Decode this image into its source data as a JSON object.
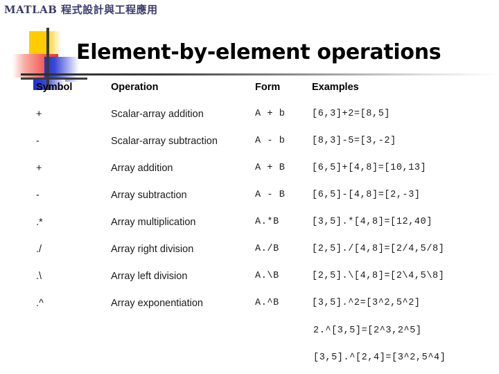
{
  "header": {
    "running_title": "MATLAB 程式設計與工程應用"
  },
  "title": {
    "text": "Element-by-element operations"
  },
  "decoration": {
    "name": "matlab-logo-blocks",
    "colors": {
      "yellow": "#ffcc00",
      "red": "#e8352c",
      "blue": "#1f2fd0",
      "bar": "#3a3a3a"
    }
  },
  "table": {
    "columns": [
      "Symbol",
      "Operation",
      "Form",
      "Examples"
    ],
    "rows": [
      {
        "symbol": "+",
        "operation": "Scalar-array addition",
        "form": "A + b",
        "example": "[6,3]+2=[8,5]"
      },
      {
        "symbol": "-",
        "operation": "Scalar-array subtraction",
        "form": "A - b",
        "example": "[8,3]-5=[3,-2]"
      },
      {
        "symbol": "+",
        "operation": "Array addition",
        "form": "A + B",
        "example": "[6,5]+[4,8]=[10,13]"
      },
      {
        "symbol": "-",
        "operation": "Array subtraction",
        "form": "A - B",
        "example": "[6,5]-[4,8]=[2,-3]"
      },
      {
        "symbol": ".*",
        "operation": "Array multiplication",
        "form": "A.*B",
        "example": "[3,5].*[4,8]=[12,40]"
      },
      {
        "symbol": "./",
        "operation": "Array right division",
        "form": "A./B",
        "example": "[2,5]./[4,8]=[2/4,5/8]"
      },
      {
        "symbol": ".\\",
        "operation": "Array left division",
        "form": "A.\\B",
        "example": "[2,5].\\[4,8]=[2\\4,5\\8]"
      },
      {
        "symbol": ".^",
        "operation": "Array exponentiation",
        "form": "A.^B",
        "example": "[3,5].^2=[3^2,5^2]"
      }
    ],
    "extra_examples": [
      "2.^[3,5]=[2^3,2^5]",
      "[3,5].^[2,4]=[3^2,5^4]"
    ]
  }
}
